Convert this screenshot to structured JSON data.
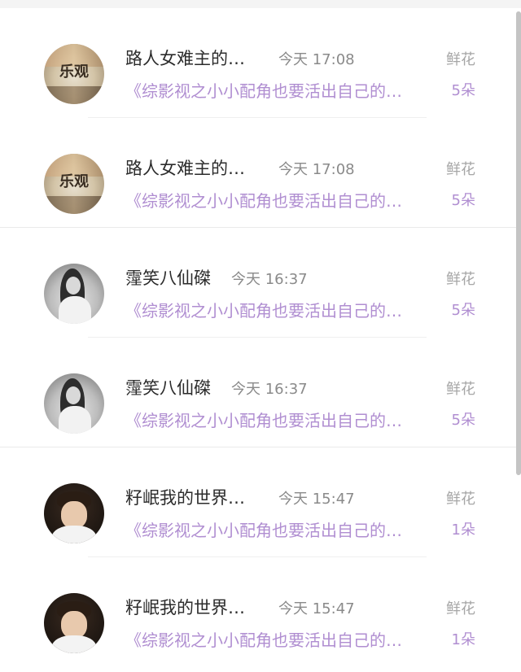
{
  "icons": {
    "avatar_leguan": "avatar-with-text",
    "avatar_girl": "avatar-photo",
    "avatar_boy": "avatar-photo"
  },
  "colors": {
    "book_title": "#b08ed1",
    "name": "#2b2b2b",
    "time": "#8a8a8a",
    "gift_label": "#a6a6a6"
  },
  "items": [
    {
      "avatar_text": "乐观",
      "name": "路人女难主的…",
      "time": "今天 17:08",
      "gift_label": "鲜花",
      "book": "《综影视之小小配角也要活出自己的…",
      "count": "5朵"
    },
    {
      "avatar_text": "乐观",
      "name": "路人女难主的…",
      "time": "今天 17:08",
      "gift_label": "鲜花",
      "book": "《综影视之小小配角也要活出自己的…",
      "count": "5朵"
    },
    {
      "name": "霪笑八仙磔",
      "time": "今天 16:37",
      "gift_label": "鲜花",
      "book": "《综影视之小小配角也要活出自己的…",
      "count": "5朵"
    },
    {
      "name": "霪笑八仙磔",
      "time": "今天 16:37",
      "gift_label": "鲜花",
      "book": "《综影视之小小配角也要活出自己的…",
      "count": "5朵"
    },
    {
      "name": "籽岷我的世界…",
      "time": "今天 15:47",
      "gift_label": "鲜花",
      "book": "《综影视之小小配角也要活出自己的…",
      "count": "1朵"
    },
    {
      "name": "籽岷我的世界…",
      "time": "今天 15:47",
      "gift_label": "鲜花",
      "book": "《综影视之小小配角也要活出自己的…",
      "count": "1朵"
    }
  ]
}
